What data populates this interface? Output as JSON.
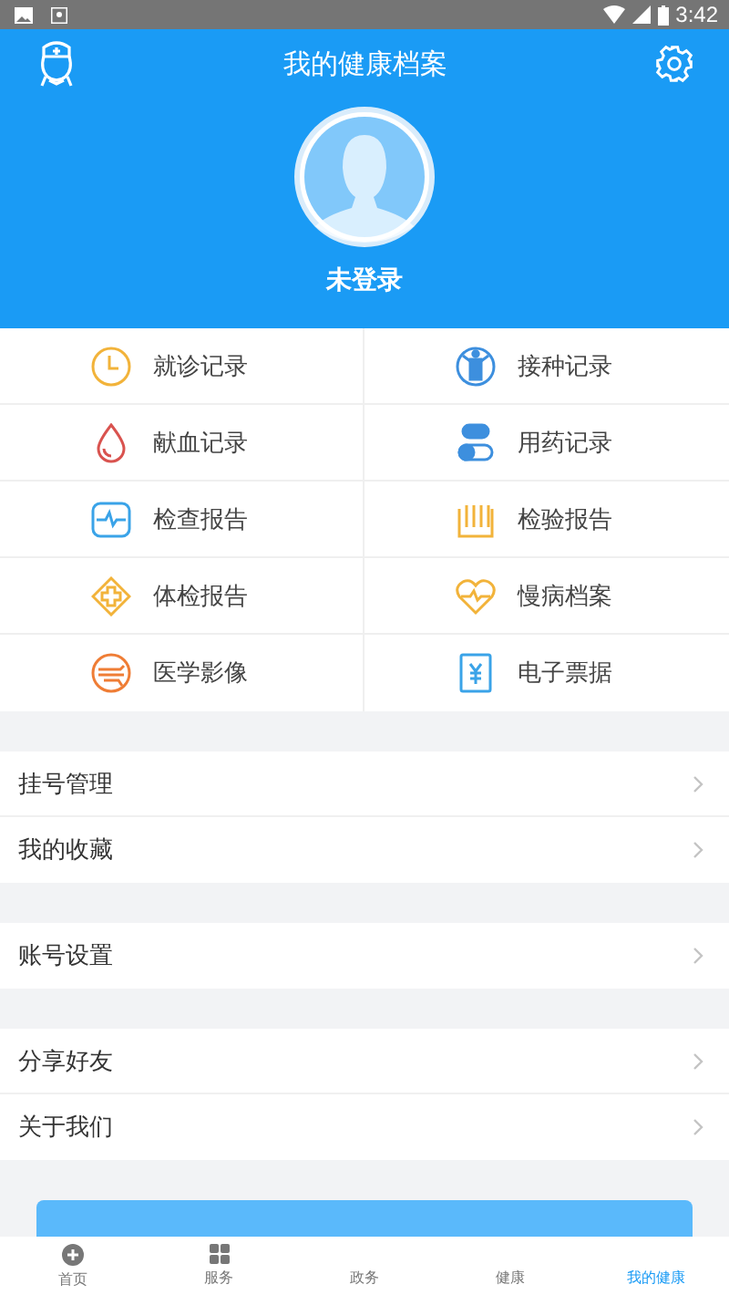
{
  "status_bar": {
    "time": "3:42"
  },
  "header": {
    "title": "我的健康档案",
    "user_name": "未登录"
  },
  "records": [
    {
      "label": "就诊记录"
    },
    {
      "label": "接种记录"
    },
    {
      "label": "献血记录"
    },
    {
      "label": "用药记录"
    },
    {
      "label": "检查报告"
    },
    {
      "label": "检验报告"
    },
    {
      "label": "体检报告"
    },
    {
      "label": "慢病档案"
    },
    {
      "label": "医学影像"
    },
    {
      "label": "电子票据"
    }
  ],
  "menu_groups": [
    [
      {
        "label": "挂号管理"
      },
      {
        "label": "我的收藏"
      }
    ],
    [
      {
        "label": "账号设置"
      }
    ],
    [
      {
        "label": "分享好友"
      },
      {
        "label": "关于我们"
      }
    ]
  ],
  "bottom_nav": [
    {
      "label": "首页",
      "selected": false
    },
    {
      "label": "服务",
      "selected": false
    },
    {
      "label": "政务",
      "selected": false
    },
    {
      "label": "健康",
      "selected": false
    },
    {
      "label": "我的健康",
      "selected": true
    }
  ]
}
